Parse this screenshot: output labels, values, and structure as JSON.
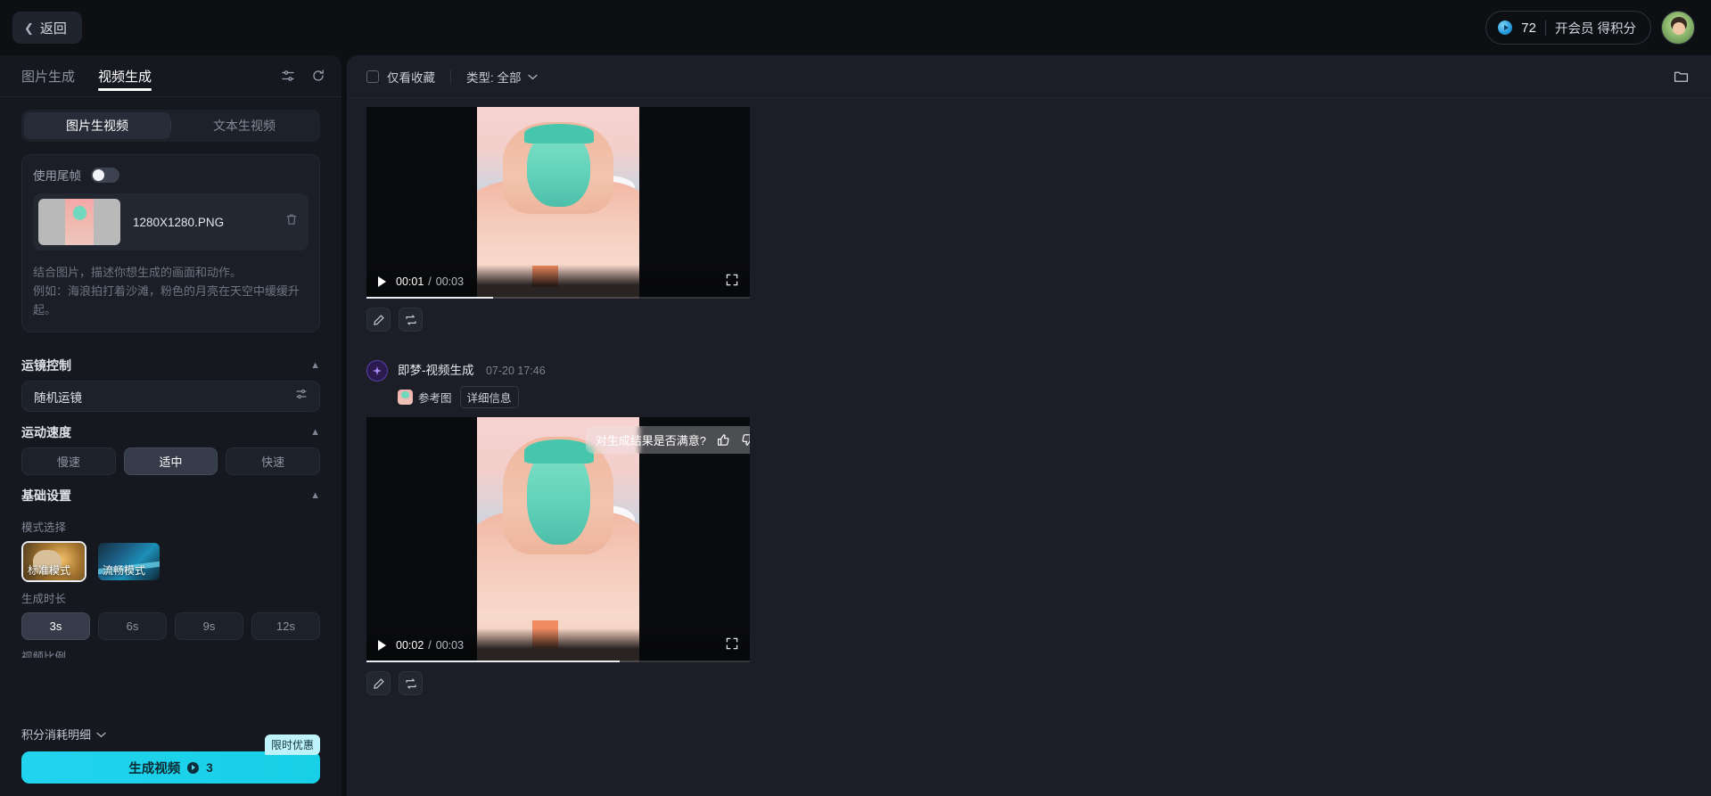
{
  "topbar": {
    "back_label": "返回",
    "back_icon": "chevron-left-icon",
    "credits": "72",
    "member_link": "开会员 得积分",
    "coin_icon": "coin-icon",
    "avatar_icon": "user-avatar"
  },
  "sidebar": {
    "tabs": [
      {
        "label": "图片生成",
        "active": false
      },
      {
        "label": "视频生成",
        "active": true
      }
    ],
    "tools": [
      {
        "name": "settings-sliders-icon"
      },
      {
        "name": "history-reset-icon"
      }
    ],
    "mode_segment": [
      {
        "label": "图片生视频",
        "active": true
      },
      {
        "label": "文本生视频",
        "active": false
      }
    ],
    "tail_frame": {
      "label": "使用尾帧",
      "enabled": false
    },
    "file": {
      "name": "1280X1280.PNG",
      "delete_icon": "trash-icon"
    },
    "prompt_placeholder": "结合图片，描述你想生成的画面和动作。\n例如：海浪拍打着沙滩，粉色的月亮在天空中缓缓升起。",
    "camera_section": {
      "title": "运镜控制",
      "value": "随机运镜",
      "caret": "chevron-up-icon"
    },
    "speed_section": {
      "title": "运动速度",
      "caret": "chevron-up-icon",
      "options": [
        {
          "label": "慢速",
          "active": false
        },
        {
          "label": "适中",
          "active": true
        },
        {
          "label": "快速",
          "active": false
        }
      ]
    },
    "basic_section": {
      "title": "基础设置",
      "caret": "chevron-up-icon",
      "mode_label": "模式选择",
      "modes": [
        {
          "label": "标准模式",
          "active": true
        },
        {
          "label": "流畅模式",
          "active": false
        }
      ],
      "duration_label": "生成时长",
      "durations": [
        {
          "label": "3s",
          "active": true
        },
        {
          "label": "6s",
          "active": false
        },
        {
          "label": "9s",
          "active": false
        },
        {
          "label": "12s",
          "active": false
        }
      ],
      "ratio_label": "视频比例"
    },
    "credit_detail": "积分消耗明细",
    "generate_button": {
      "label": "生成视频",
      "cost": "3",
      "promo": "限时优惠"
    }
  },
  "gallery": {
    "favorites_label": "仅看收藏",
    "favorites_checked": false,
    "filter_label": "类型: 全部",
    "filter_caret": "chevron-down-icon",
    "folder_icon": "folder-icon",
    "cards": [
      {
        "player": {
          "current": "00:01",
          "total": "00:03",
          "progress": 33,
          "play_icon": "play-icon",
          "fullscreen_icon": "fullscreen-icon"
        },
        "actions": [
          {
            "name": "edit-icon"
          },
          {
            "name": "regenerate-icon"
          }
        ]
      },
      {
        "brand": "即梦-视频生成",
        "timestamp": "07-20  17:46",
        "brand_icon": "sparkle-icon",
        "tags": [
          {
            "label": "参考图",
            "type": "thumb"
          },
          {
            "label": "详细信息",
            "type": "box"
          }
        ],
        "player": {
          "current": "00:02",
          "total": "00:03",
          "progress": 66,
          "play_icon": "play-icon",
          "fullscreen_icon": "fullscreen-icon"
        },
        "toast": {
          "text": "对生成结果是否满意?",
          "like_icon": "thumbs-up-icon",
          "dislike_icon": "thumbs-down-icon",
          "close_icon": "close-icon"
        },
        "actions": [
          {
            "name": "edit-icon"
          },
          {
            "name": "regenerate-icon"
          }
        ]
      }
    ]
  }
}
